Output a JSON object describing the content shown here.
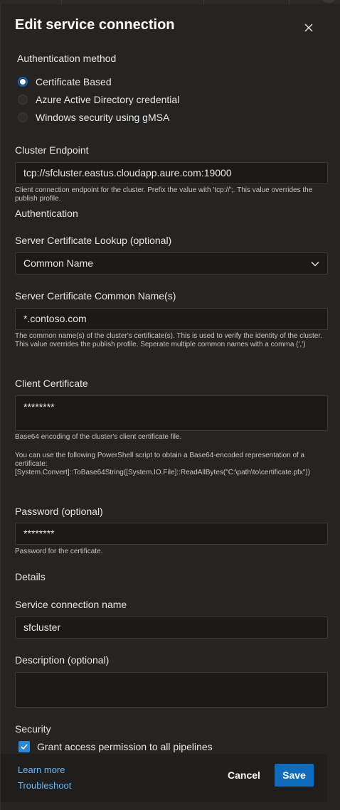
{
  "dialog": {
    "title": "Edit service connection"
  },
  "auth_method": {
    "label": "Authentication method",
    "options": [
      {
        "label": "Certificate Based",
        "selected": true
      },
      {
        "label": "Azure Active Directory credential",
        "selected": false
      },
      {
        "label": "Windows security using gMSA",
        "selected": false
      }
    ]
  },
  "cluster_endpoint": {
    "label": "Cluster Endpoint",
    "value": "tcp://sfcluster.eastus.cloudapp.aure.com:19000",
    "help": "Client connection endpoint for the cluster. Prefix the value with 'tcp://';. This value overrides the publish profile."
  },
  "authentication_heading": "Authentication",
  "server_cert_lookup": {
    "label": "Server Certificate Lookup (optional)",
    "selected": "Common Name"
  },
  "server_cert_common_names": {
    "label": "Server Certificate Common Name(s)",
    "value": "*.contoso.com",
    "help": "The common name(s) of the cluster's certificate(s). This is used to verify the identity of the cluster. This value overrides the publish profile. Seperate multiple common names with a comma (',')"
  },
  "client_certificate": {
    "label": "Client Certificate",
    "value": "********",
    "help1": "Base64 encoding of the cluster's client certificate file.",
    "help2": "You can use the following PowerShell script to obtain a Base64-encoded representation of a certificate:",
    "help3": "[System.Convert]::ToBase64String([System.IO.File]::ReadAllBytes(\"C:\\path\\to\\certificate.pfx\"))"
  },
  "password": {
    "label": "Password (optional)",
    "value": "********",
    "help": "Password for the certificate."
  },
  "details_heading": "Details",
  "service_connection_name": {
    "label": "Service connection name",
    "value": "sfcluster"
  },
  "description": {
    "label": "Description (optional)",
    "value": ""
  },
  "security": {
    "heading": "Security",
    "grant_label": "Grant access permission to all pipelines",
    "grant_checked": true
  },
  "footer": {
    "learn_more": "Learn more",
    "troubleshoot": "Troubleshoot",
    "cancel": "Cancel",
    "save": "Save"
  },
  "colors": {
    "accent": "#0f6cbd",
    "link": "#6cb8f6",
    "panel": "#252423"
  }
}
